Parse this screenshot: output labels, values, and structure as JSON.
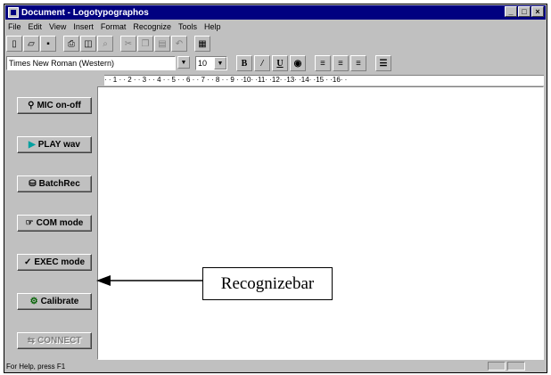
{
  "window": {
    "title": "Document - Logotypographos",
    "controls": [
      "_",
      "□",
      "×"
    ]
  },
  "menu": [
    "File",
    "Edit",
    "View",
    "Insert",
    "Format",
    "Recognize",
    "Tools",
    "Help"
  ],
  "toolbar": {
    "icons": [
      "new-doc-icon",
      "open-folder-icon",
      "save-icon",
      "print-icon",
      "print-preview-icon",
      "find-icon",
      "cut-icon",
      "copy-icon",
      "paste-icon",
      "undo-icon",
      "insert-object-icon"
    ]
  },
  "format": {
    "font": "Times New Roman (Western)",
    "size": "10",
    "bold": "B",
    "italic": "/",
    "underline": "U"
  },
  "ruler": {
    "text": "·  ·  1  ·  ·  2  ·  ·  3  ·  ·  4  ·  ·  5  ·  ·  6  ·  ·  7  ·  ·  8  ·  ·  9  ·  ·10·  ·11·  ·12·  ·13·  ·14·  ·15  ·  ·16·  ·"
  },
  "recognizebar": {
    "buttons": [
      {
        "label": "MIC on-off",
        "icon": "microphone-icon",
        "enabled": true
      },
      {
        "label": "PLAY wav",
        "icon": "play-icon",
        "enabled": true
      },
      {
        "label": "BatchRec",
        "icon": "batch-icon",
        "enabled": true
      },
      {
        "label": "COM mode",
        "icon": "hand-icon",
        "enabled": true
      },
      {
        "label": "EXEC mode",
        "icon": "check-icon",
        "enabled": true
      },
      {
        "label": "Calibrate",
        "icon": "calibrate-icon",
        "enabled": true
      },
      {
        "label": "CONNECT",
        "icon": "connect-icon",
        "enabled": false
      }
    ]
  },
  "status": {
    "text": "For Help, press F1"
  },
  "annotation": {
    "label": "Recognizebar"
  },
  "colors": {
    "titlebar": "#000080",
    "face": "#c0c0c0"
  }
}
